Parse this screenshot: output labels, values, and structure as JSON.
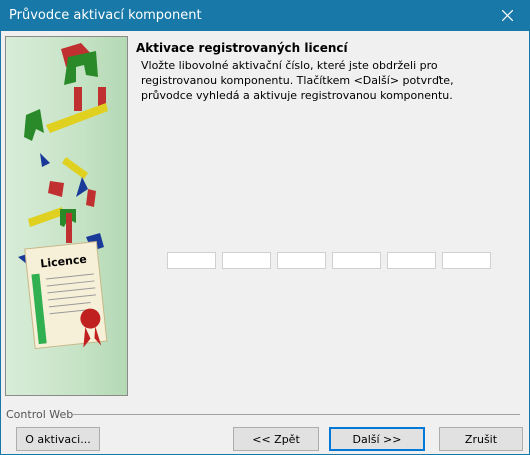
{
  "window": {
    "title": "Průvodce aktivací komponent",
    "close_icon": "close-icon"
  },
  "content": {
    "heading": "Aktivace registrovaných licencí",
    "description": "Vložte libovolné aktivační číslo, které jste obdrželi pro registrovanou komponentu. Tlačítkem <Další> potvrďte, průvodce vyhledá a aktivuje registrovanou komponentu.",
    "key_fields": [
      "",
      "",
      "",
      "",
      "",
      ""
    ]
  },
  "sidebar": {
    "image_text": "Licence",
    "image_icon": "license-certificate-illustration"
  },
  "footer": {
    "group_label": "Control Web",
    "about_label": "O aktivaci...",
    "back_label": "<< Zpět",
    "next_label": "Další >>",
    "cancel_label": "Zrušit"
  },
  "colors": {
    "titlebar": "#1879a8",
    "accent": "#0078d7",
    "sidebar": "#c6e3c6"
  }
}
